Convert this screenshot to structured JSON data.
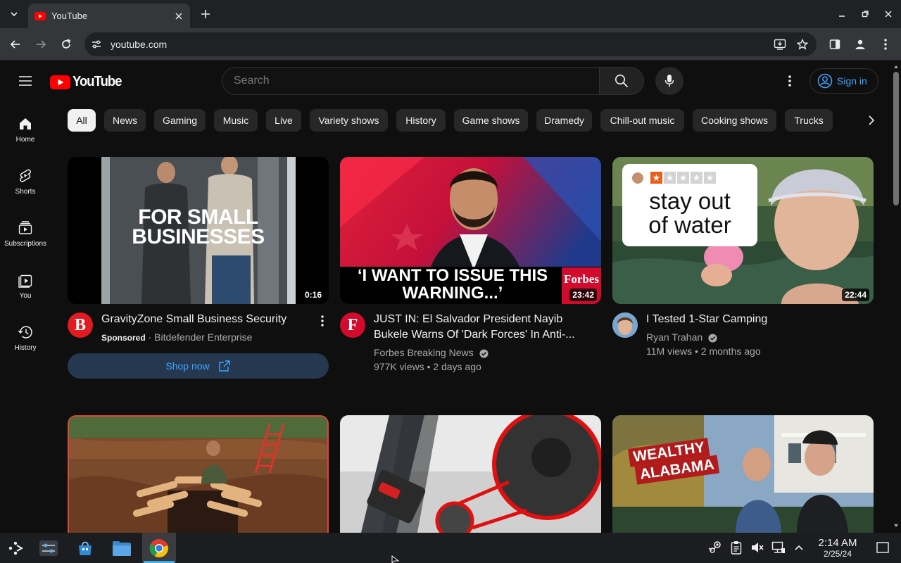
{
  "browser": {
    "tab_title": "YouTube",
    "url": "youtube.com"
  },
  "header": {
    "logo_text": "YouTube",
    "search_placeholder": "Search",
    "signin_label": "Sign in"
  },
  "rail": {
    "items": [
      {
        "label": "Home",
        "icon": "home-icon"
      },
      {
        "label": "Shorts",
        "icon": "shorts-icon"
      },
      {
        "label": "Subscriptions",
        "icon": "subscriptions-icon"
      },
      {
        "label": "You",
        "icon": "you-icon"
      },
      {
        "label": "History",
        "icon": "history-icon"
      }
    ]
  },
  "chips": [
    "All",
    "News",
    "Gaming",
    "Music",
    "Live",
    "Variety shows",
    "History",
    "Game shows",
    "Dramedy",
    "Chill-out music",
    "Cooking shows",
    "Trucks"
  ],
  "videos": [
    {
      "title": "GravityZone Small Business Security",
      "sponsored_label": "Sponsored",
      "channel": "Bitdefender Enterprise",
      "duration": "0:16",
      "thumb_text_1": "FOR SMALL",
      "thumb_text_2": "BUSINESSES",
      "avatar_letter": "B",
      "cta_label": "Shop now"
    },
    {
      "title_line1": "JUST IN: El Salvador President Nayib",
      "title_line2": "Bukele Warns Of 'Dark Forces' In Anti-...",
      "channel": "Forbes Breaking News",
      "stats": "977K views • 2 days ago",
      "duration": "23:42",
      "thumb_text_1": "‘I WANT TO ISSUE THIS",
      "thumb_text_2": "WARNING...’",
      "thumb_brand": "Forbes",
      "avatar_letter": "F"
    },
    {
      "title": "I Tested 1-Star Camping",
      "channel": "Ryan Trahan",
      "stats": "11M views • 2 months ago",
      "duration": "22:44",
      "thumb_text_1": "stay out",
      "thumb_text_2": "of water",
      "rating_stars": 1,
      "rating_max": 5
    },
    {
      "thumb": "log-pit"
    },
    {
      "thumb": "seatbelt"
    },
    {
      "thumb_text_1": "WEALTHY",
      "thumb_text_2": "ALABAMA"
    }
  ],
  "taskbar": {
    "time": "2:14 AM",
    "date": "2/25/24"
  },
  "colors": {
    "youtube_red": "#ff0000",
    "link_blue": "#3ea6ff",
    "background": "#0f0f0f"
  }
}
